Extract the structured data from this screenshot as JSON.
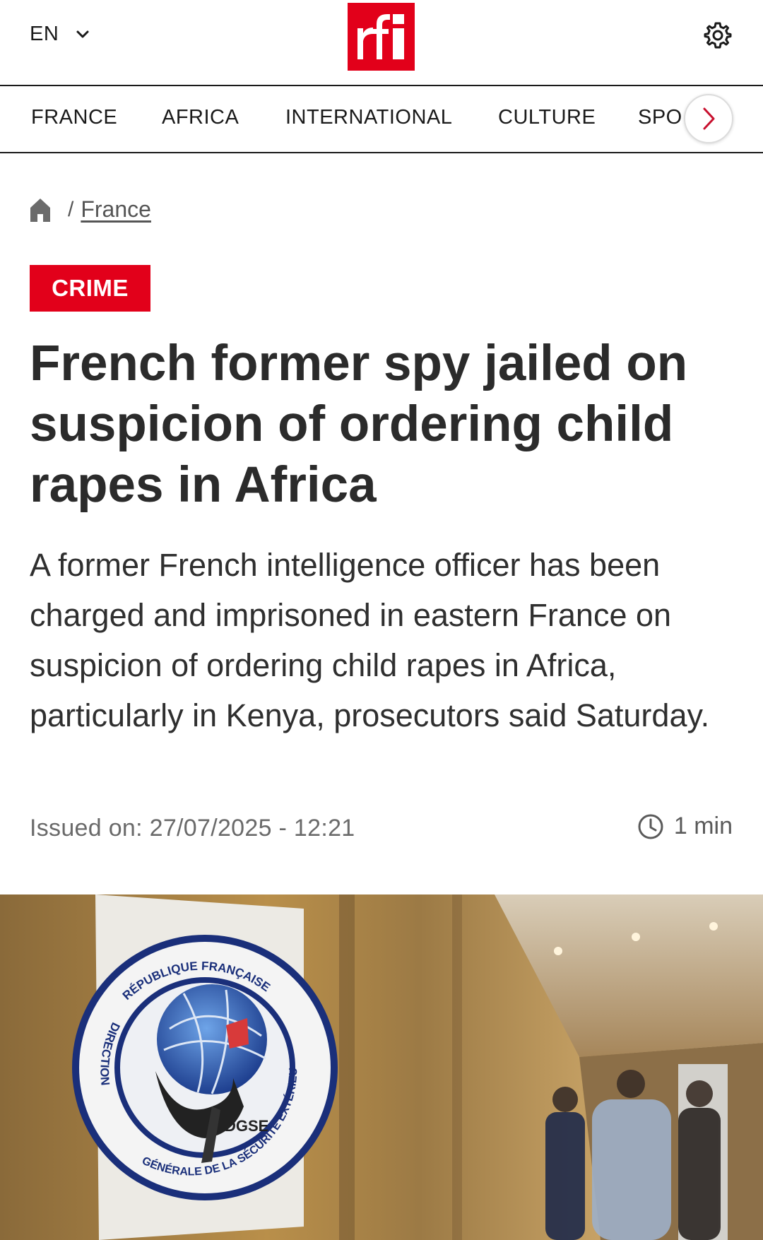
{
  "header": {
    "language": "EN",
    "logo_text": "rfi"
  },
  "nav": {
    "items": [
      "FRANCE",
      "AFRICA",
      "INTERNATIONAL",
      "CULTURE",
      "SPO"
    ]
  },
  "breadcrumb": {
    "section": "France"
  },
  "article": {
    "tag": "CRIME",
    "title": "French former spy jailed on suspicion of ordering child rapes in Africa",
    "lead": "A former French intelligence officer has been charged and imprisoned in eastern France on suspicion of ordering child rapes in Africa, particularly in Kenya, prosecutors said Saturday.",
    "issued": "Issued on: 27/07/2025 - 12:21",
    "read_time": "1 min"
  },
  "hero": {
    "seal_top_text": "RÉPUBLIQUE FRANÇAISE",
    "seal_left_text": "DIRECTION",
    "seal_bottom_text": "GÉNÉRALE DE LA SÉCURITÉ EXTÉRIEURE",
    "seal_center_text": "DGSE"
  },
  "colors": {
    "brand_red": "#e2001a",
    "text_dark": "#2b2b2b",
    "text_muted": "#6a6a6a"
  },
  "icons": [
    "chevron-down-icon",
    "gear-icon",
    "chevron-right-icon",
    "home-icon",
    "clock-icon"
  ]
}
